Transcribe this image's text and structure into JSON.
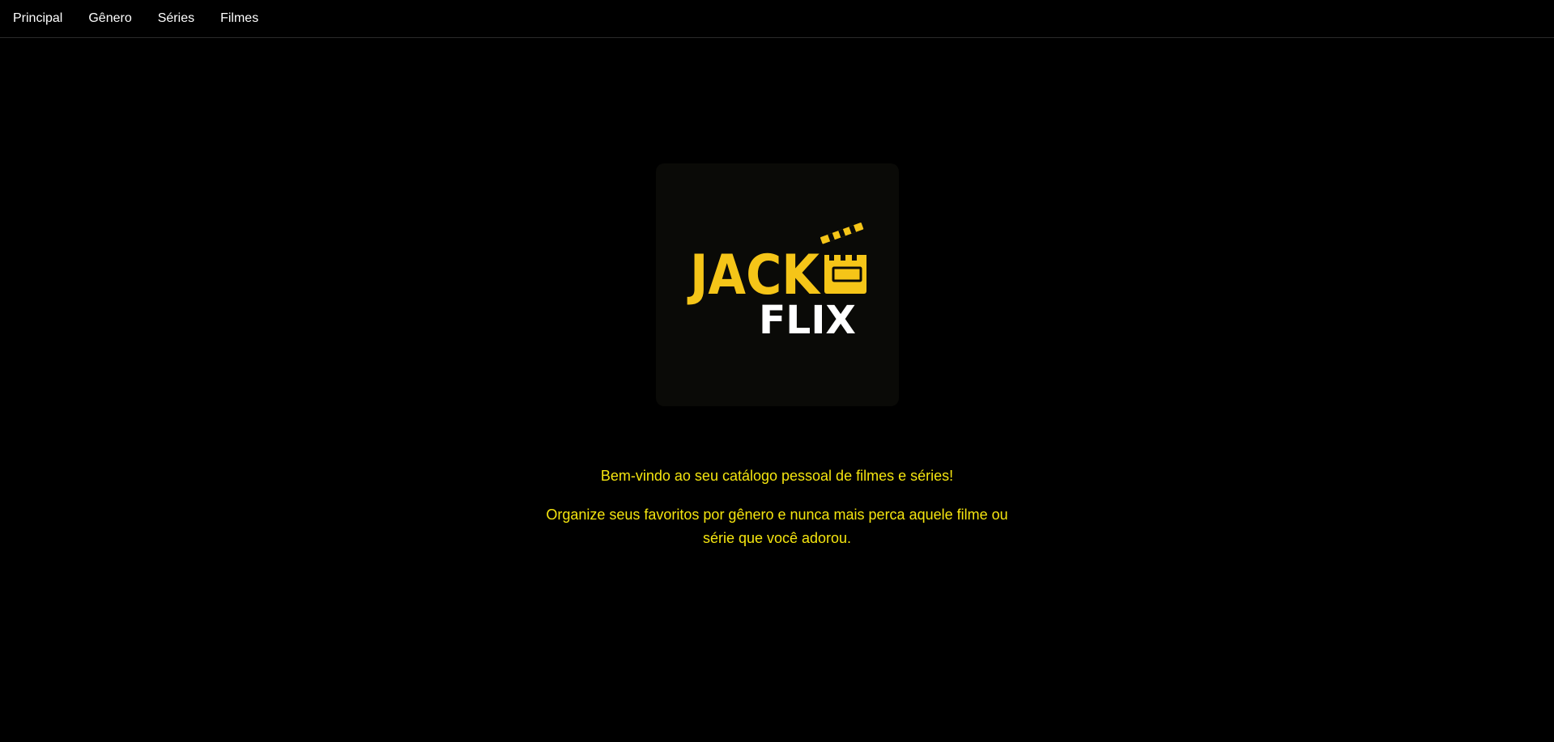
{
  "nav": {
    "items": [
      {
        "label": "Principal"
      },
      {
        "label": "Gênero"
      },
      {
        "label": "Séries"
      },
      {
        "label": "Filmes"
      }
    ]
  },
  "logo": {
    "word_top": "JACK",
    "word_bottom": "FLIX",
    "icon": "clapperboard-icon",
    "colors": {
      "primary": "#f5c518",
      "secondary": "#ffffff",
      "card": "#0a0a07"
    }
  },
  "main": {
    "welcome_text": "Bem-vindo ao seu catálogo pessoal de filmes e séries!",
    "description_text": "Organize seus favoritos por gênero e nunca mais perca aquele filme ou série que você adorou."
  },
  "theme": {
    "background": "#000000",
    "nav_text": "#ffffff",
    "accent_text": "#f5e50f"
  }
}
